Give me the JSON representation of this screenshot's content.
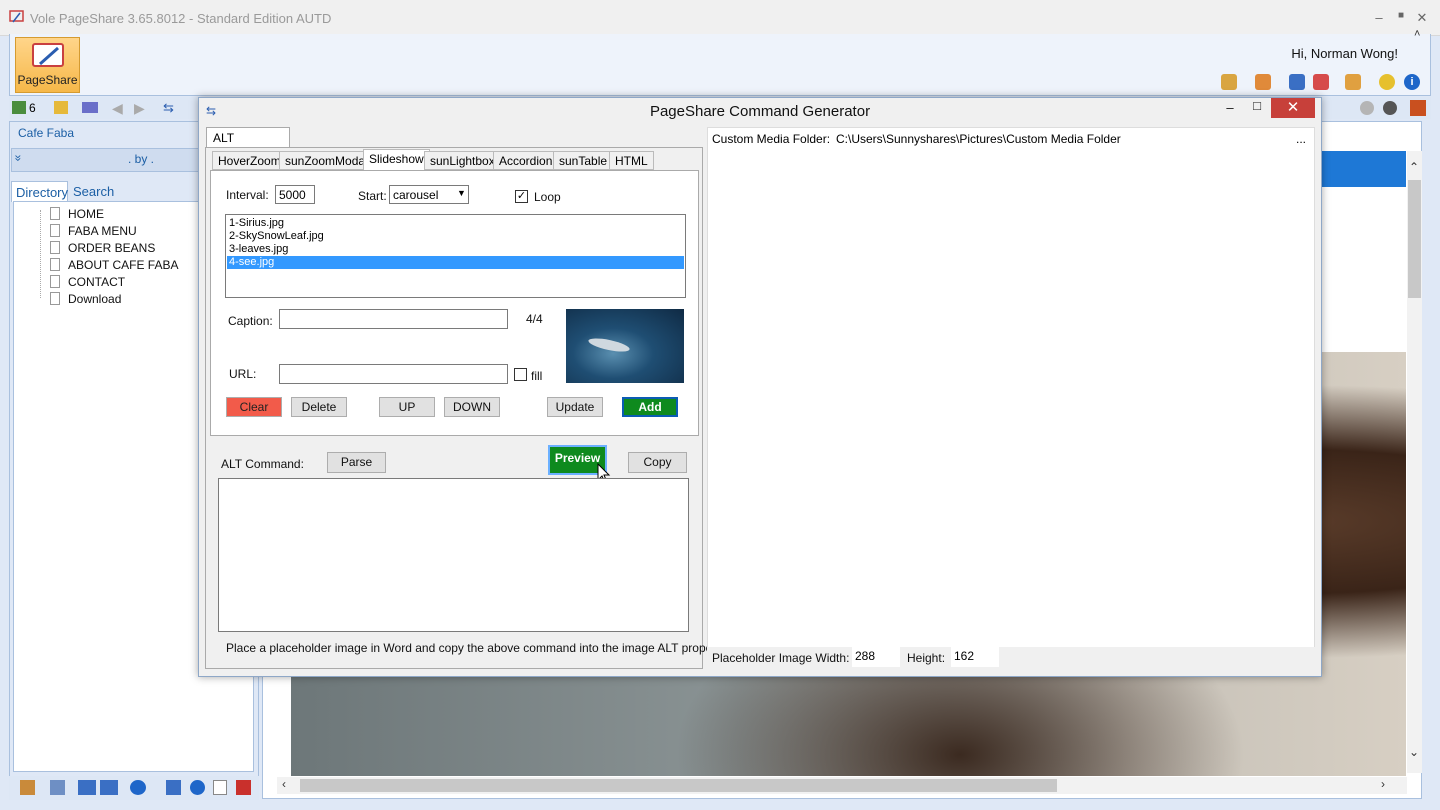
{
  "window": {
    "title": "Vole PageShare  3.65.8012 - Standard Edition AUTD",
    "minimize": "–",
    "maximize": "■",
    "close": "✕"
  },
  "ribbon": {
    "pageshare_label": "PageShare",
    "greeting": "Hi, Norman Wong!",
    "collapse": "˄"
  },
  "toolbar": {
    "count": "6"
  },
  "sidebar": {
    "site_name": "Cafe Faba",
    "byline": ". by .",
    "expand_glyph": "»",
    "tabs": [
      "Directory",
      "Search"
    ],
    "items": [
      "HOME",
      "FABA MENU",
      "ORDER BEANS",
      "ABOUT CAFE FABA",
      "CONTACT",
      "Download"
    ]
  },
  "dialog": {
    "title": "PageShare Command Generator",
    "minimize": "–",
    "maximize": "□",
    "close": "✕",
    "outer_tab": "ALT Command",
    "sub_tabs": [
      "HoverZoom",
      "sunZoomModal",
      "Slideshow",
      "sunLightbox",
      "Accordion",
      "sunTable",
      "HTML"
    ],
    "active_sub_tab": "Slideshow",
    "slideshow": {
      "interval_label": "Interval:",
      "interval_value": "5000",
      "start_label": "Start:",
      "start_value": "carousel",
      "loop_label": "Loop",
      "loop_checked": true,
      "files": [
        "1-Sirius.jpg",
        "2-SkySnowLeaf.jpg",
        "3-leaves.jpg",
        "4-see.jpg"
      ],
      "selected_index": 3,
      "caption_label": "Caption:",
      "caption_value": "",
      "counter": "4/4",
      "url_label": "URL:",
      "url_value": "",
      "fill_label": "fill",
      "fill_checked": false,
      "buttons": {
        "clear": "Clear",
        "delete": "Delete",
        "up": "UP",
        "down": "DOWN",
        "update": "Update",
        "add": "Add"
      }
    },
    "alt_command_label": "ALT Command:",
    "parse_label": "Parse",
    "preview_label": "Preview",
    "copy_label": "Copy",
    "alt_command_value": "",
    "hint": "Place a placeholder image in Word and copy the above command into the image ALT property.",
    "custom_media_label": "Custom Media Folder:",
    "custom_media_path": "C:\\Users\\Sunnyshares\\Pictures\\Custom Media Folder",
    "browse": "...",
    "placeholder_width_label": "Placeholder Image Width:",
    "placeholder_width": "288",
    "placeholder_height_label": "Height:",
    "placeholder_height": "162"
  },
  "colors": {
    "accent_blue": "#1e78d6",
    "add_green": "#0e8a1e",
    "clear_red": "#f25b4a",
    "close_red": "#c7403a",
    "selection": "#3399ff"
  }
}
